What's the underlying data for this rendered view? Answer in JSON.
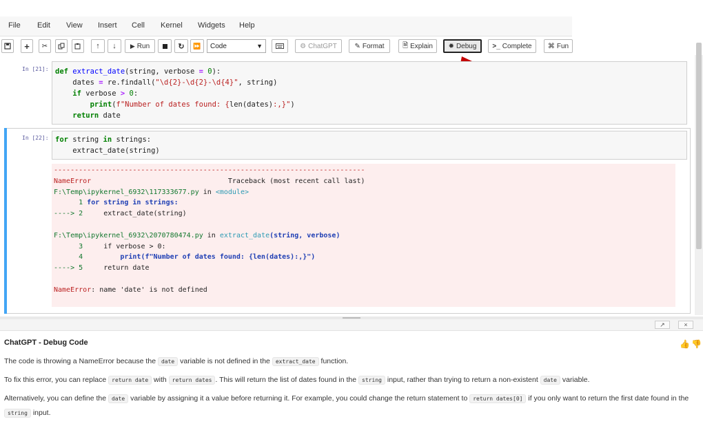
{
  "menubar": {
    "items": [
      "File",
      "Edit",
      "View",
      "Insert",
      "Cell",
      "Kernel",
      "Widgets",
      "Help"
    ]
  },
  "toolbar": {
    "run_label": "Run",
    "cell_type": "Code",
    "chatgpt_label": "ChatGPT",
    "format_label": "Format",
    "explain_label": "Explain",
    "debug_label": "Debug",
    "complete_label": "Complete",
    "fun_label": "Fun"
  },
  "cells": [
    {
      "prompt": "In [21]:",
      "lines": [
        "def extract_date(string, verbose = 0):",
        "    dates = re.findall(\"\\d{2}-\\d{2}-\\d{4}\", string)",
        "    if verbose > 0:",
        "        print(f\"Number of dates found: {len(dates):,}\")",
        "    return date"
      ]
    },
    {
      "prompt": "In [22]:",
      "lines": [
        "for string in strings:",
        "    extract_date(string)"
      ]
    }
  ],
  "traceback": {
    "divider": "---------------------------------------------------------------------------",
    "error_name": "NameError",
    "header": "Traceback (most recent call last)",
    "file1": "F:\\Temp\\ipykernel_6932\\117333677.py",
    "in_word": "in",
    "module": "<module>",
    "f1_line1_num": "      1",
    "f1_line1_code": " for string in strings:",
    "f1_arrow": "----> 2",
    "f1_line2_code": "     extract_date(string)",
    "file2": "F:\\Temp\\ipykernel_6932\\2070780474.py",
    "func": "extract_date",
    "args": "(string, verbose)",
    "f2_l3_num": "      3",
    "f2_l3_code": "     if verbose > 0:",
    "f2_l4_num": "      4",
    "f2_l4_code": "         print(f\"Number of dates found: {len(dates):,}\")",
    "f2_arrow": "----> 5",
    "f2_l5_code": "     return date",
    "final_name": "NameError",
    "final_msg": ": name 'date' is not defined"
  },
  "panel": {
    "popout_icon": "↗",
    "close_icon": "×",
    "title": "ChatGPT - Debug Code",
    "p1": {
      "a": "The code is throwing a NameError because the ",
      "c1": "date",
      "b": " variable is not defined in the ",
      "c2": "extract_date",
      "c": " function."
    },
    "p2": {
      "a": "To fix this error, you can replace ",
      "c1": "return date",
      "b": " with ",
      "c2": "return dates",
      "c": ". This will return the list of dates found in the ",
      "c3": "string",
      "d": " input, rather than trying to return a non-existent ",
      "c4": "date",
      "e": " variable."
    },
    "p3": {
      "a": "Alternatively, you can define the ",
      "c1": "date",
      "b": " variable by assigning it a value before returning it. For example, you could change the return statement to ",
      "c2": "return dates[0]",
      "c": " if you only want to return the first date found in the ",
      "c3": "string",
      "d": " input."
    }
  },
  "colors": {
    "accent": "#42a5f5",
    "error_bg": "#fdeeee",
    "arrow": "#c40000"
  }
}
